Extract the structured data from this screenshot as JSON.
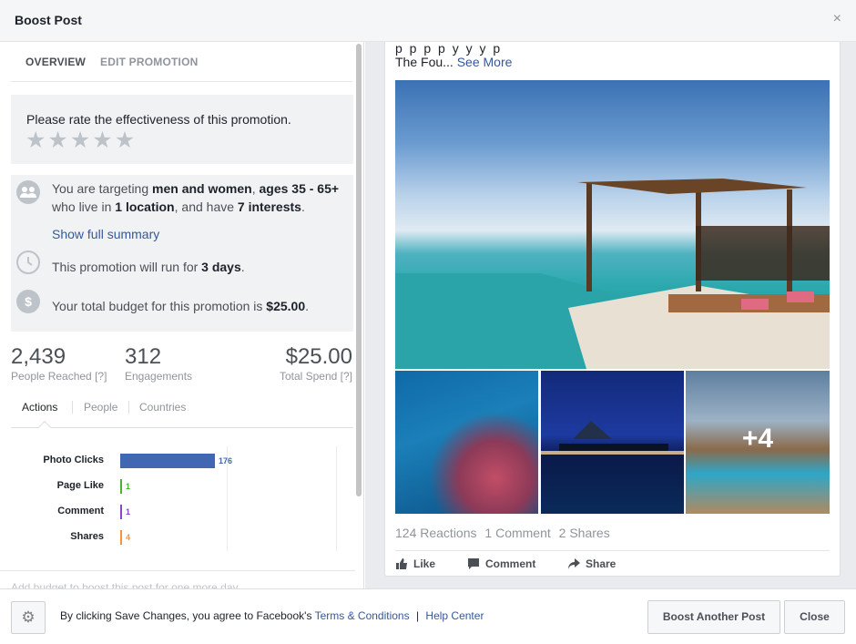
{
  "header": {
    "title": "Boost Post",
    "close_glyph": "×"
  },
  "left": {
    "tabs": {
      "overview": "OVERVIEW",
      "edit": "EDIT PROMOTION"
    },
    "rating": {
      "question": "Please rate the effectiveness of this promotion.",
      "stars": [
        "★",
        "★",
        "★",
        "★",
        "★"
      ]
    },
    "targeting": {
      "l1_pre": "You are targeting ",
      "l1_b1": "men and women",
      "l1_mid": ", ",
      "l1_b2": "ages 35 - 65+",
      "l2_pre": "who live in ",
      "l2_b1": "1 location",
      "l2_mid": ", and have ",
      "l2_b2": "7 interests",
      "l2_end": ".",
      "show_full": "Show full summary",
      "duration_pre": "This promotion will run for ",
      "duration_b": "3 days",
      "duration_end": ".",
      "budget_pre": "Your total budget for this promotion is ",
      "budget_b": "$25.00",
      "budget_end": "."
    },
    "stats": {
      "reached_num": "2,439",
      "reached_lbl": "People Reached [?]",
      "eng_num": "312",
      "eng_lbl": "Engagements",
      "spend_num": "$25.00",
      "spend_lbl": "Total Spend [?]"
    },
    "subtabs": {
      "actions": "Actions",
      "people": "People",
      "countries": "Countries"
    },
    "more_budget": "Add budget to boost this post for one more day"
  },
  "chart_data": {
    "type": "bar",
    "orientation": "horizontal",
    "categories": [
      "Photo Clicks",
      "Page Like",
      "Comment",
      "Shares"
    ],
    "values": [
      176,
      1,
      1,
      4
    ],
    "colors": [
      "#4267b2",
      "#42b72a",
      "#8c44c8",
      "#f7923b"
    ],
    "title": "",
    "xlabel": "",
    "ylabel": ""
  },
  "post": {
    "cut_text": "p  p      p     p      y   y     y     p",
    "text_pre": "The Fou... ",
    "see_more": "See More",
    "plus_more": "+4",
    "reactions": "124 Reactions",
    "comments": "1 Comment",
    "shares": "2 Shares",
    "like": "Like",
    "comment": "Comment",
    "share": "Share"
  },
  "footer": {
    "terms_pre": "By clicking Save Changes, you agree to Facebook's ",
    "terms_link": "Terms & Conditions",
    "sep": " | ",
    "help": "Help Center",
    "boost_another": "Boost Another Post",
    "close": "Close"
  }
}
